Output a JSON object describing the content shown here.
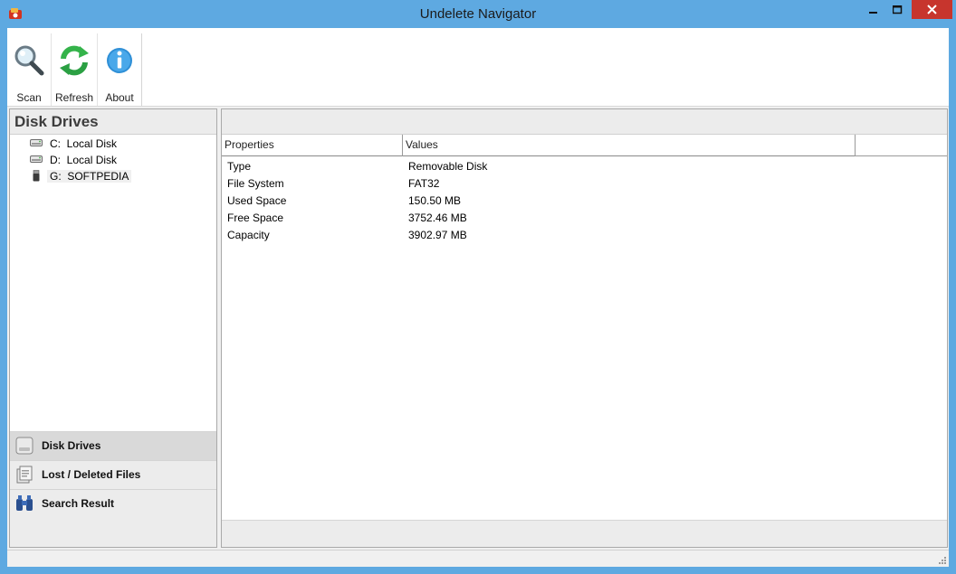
{
  "window": {
    "title": "Undelete Navigator",
    "accent": "#5ea9e1",
    "close_color": "#c7352d"
  },
  "toolbar": {
    "items": [
      {
        "label": "Scan",
        "icon": "magnifier-icon"
      },
      {
        "label": "Refresh",
        "icon": "refresh-icon"
      },
      {
        "label": "About",
        "icon": "info-icon"
      }
    ]
  },
  "left_pane": {
    "title": "Disk Drives",
    "drives": [
      {
        "letter": "C:",
        "name": "Local Disk",
        "icon": "hard-drive-icon"
      },
      {
        "letter": "D:",
        "name": "Local Disk",
        "icon": "hard-drive-icon"
      },
      {
        "letter": "G:",
        "name": "SOFTPEDIA",
        "icon": "usb-drive-icon",
        "selected": true
      }
    ],
    "nav": [
      {
        "label": "Disk Drives",
        "icon": "disk-drives-icon",
        "active": true
      },
      {
        "label": "Lost / Deleted Files",
        "icon": "lost-files-icon"
      },
      {
        "label": "Search Result",
        "icon": "binoculars-icon"
      }
    ]
  },
  "properties": {
    "headers": [
      "Properties",
      "Values"
    ],
    "rows": [
      {
        "property": "Type",
        "value": "Removable Disk"
      },
      {
        "property": "File System",
        "value": "FAT32"
      },
      {
        "property": "Used Space",
        "value": "150.50 MB"
      },
      {
        "property": "Free Space",
        "value": "3752.46 MB"
      },
      {
        "property": "Capacity",
        "value": "3902.97 MB"
      }
    ]
  }
}
